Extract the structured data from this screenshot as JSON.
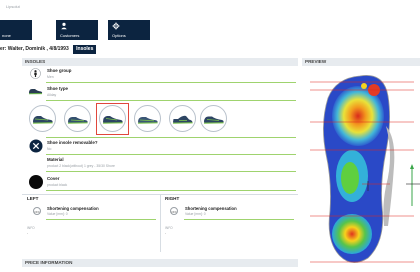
{
  "app": {
    "name": "Lipsolut"
  },
  "nav": [
    {
      "label": "none",
      "icon": "home-icon"
    },
    {
      "label": "Customers",
      "icon": "person-icon"
    },
    {
      "label": "Options",
      "icon": "gear-icon"
    }
  ],
  "breadcrumb": {
    "text": "er: Walter, Dominik , 4/8/1993",
    "active": "Insoles"
  },
  "insoles": {
    "header": "INSOLES",
    "shoe_group": {
      "title": "Shoe group",
      "value": "Men"
    },
    "shoe_type": {
      "title": "Shoe type",
      "value": "Allday"
    },
    "shoe_options_count_label": "",
    "removable": {
      "title": "Shoe insole removable?",
      "value": "No"
    },
    "material": {
      "title": "Material",
      "value": "product 2 black(without) 1 grey - 35/30 Shore"
    },
    "cover": {
      "title": "Cover",
      "value": "product black"
    },
    "left": {
      "label": "LEFT",
      "comp_title": "Shortening compensation",
      "comp_value": "Value [mm]:  0",
      "icon_text": "OFF",
      "small_label": "INFO",
      "dash": "-"
    },
    "right": {
      "label": "RIGHT",
      "comp_title": "Shortening compensation",
      "comp_value": "Value [mm]:  0",
      "icon_text": "OFF",
      "small_label": "INFO",
      "dash": "-"
    }
  },
  "price": {
    "header": "PRICE INFORMATION"
  },
  "preview": {
    "header": "PREVIEW"
  },
  "colors": {
    "navy": "#0c2440",
    "accent_green": "#9fd36e",
    "selected_red": "#e0473c",
    "panel_header": "#e7ebef"
  }
}
